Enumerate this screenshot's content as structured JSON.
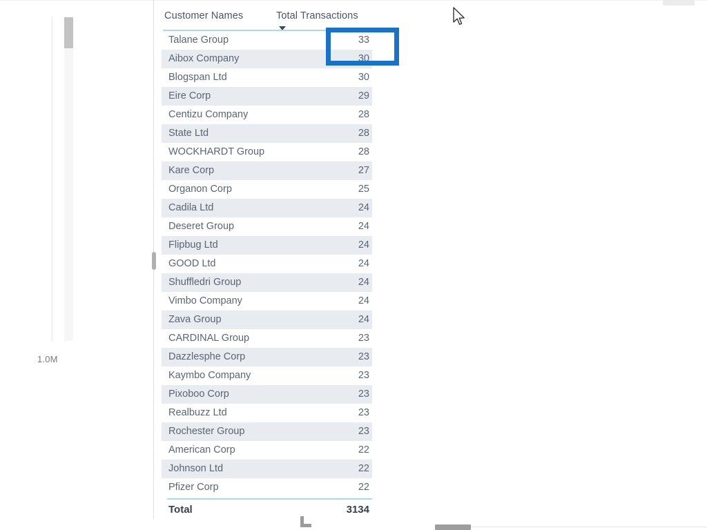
{
  "app": {
    "type": "power-bi-table-visual"
  },
  "left_chart": {
    "axis_tick_label": "1.0M"
  },
  "table": {
    "columns": [
      "Customer Names",
      "Total Transactions"
    ],
    "sort": {
      "column": "Total Transactions",
      "direction": "descending",
      "glyph": "sort-descending-icon"
    },
    "rows": [
      {
        "name": "Talane Group",
        "value": "33"
      },
      {
        "name": "Aibox Company",
        "value": "30"
      },
      {
        "name": "Blogspan Ltd",
        "value": "30"
      },
      {
        "name": "Eire Corp",
        "value": "29"
      },
      {
        "name": "Centizu Company",
        "value": "28"
      },
      {
        "name": "State Ltd",
        "value": "28"
      },
      {
        "name": "WOCKHARDT Group",
        "value": "28"
      },
      {
        "name": "Kare Corp",
        "value": "27"
      },
      {
        "name": "Organon Corp",
        "value": "25"
      },
      {
        "name": "Cadila Ltd",
        "value": "24"
      },
      {
        "name": "Deseret Group",
        "value": "24"
      },
      {
        "name": "Flipbug Ltd",
        "value": "24"
      },
      {
        "name": "GOOD Ltd",
        "value": "24"
      },
      {
        "name": "Shuffledri Group",
        "value": "24"
      },
      {
        "name": "Vimbo Company",
        "value": "24"
      },
      {
        "name": "Zava Group",
        "value": "24"
      },
      {
        "name": "CARDINAL Group",
        "value": "23"
      },
      {
        "name": "Dazzlesphe Corp",
        "value": "23"
      },
      {
        "name": "Kaymbo Company",
        "value": "23"
      },
      {
        "name": "Pixoboo Corp",
        "value": "23"
      },
      {
        "name": "Realbuzz Ltd",
        "value": "23"
      },
      {
        "name": "Rochester Group",
        "value": "23"
      },
      {
        "name": "American Corp",
        "value": "22"
      },
      {
        "name": "Johnson Ltd",
        "value": "22"
      },
      {
        "name": "Pfizer Corp",
        "value": "22"
      }
    ],
    "total_row": {
      "name": "Total",
      "value": "3134"
    }
  },
  "annotation": {
    "kind": "highlight-rectangle",
    "color": "#1b72c4",
    "targets_cell_value": "33"
  },
  "chart_data": {
    "type": "table",
    "title": "",
    "columns": [
      "Customer Names",
      "Total Transactions"
    ],
    "categories": [
      "Talane Group",
      "Aibox Company",
      "Blogspan Ltd",
      "Eire Corp",
      "Centizu Company",
      "State Ltd",
      "WOCKHARDT Group",
      "Kare Corp",
      "Organon Corp",
      "Cadila Ltd",
      "Deseret Group",
      "Flipbug Ltd",
      "GOOD Ltd",
      "Shuffledri Group",
      "Vimbo Company",
      "Zava Group",
      "CARDINAL Group",
      "Dazzlesphe Corp",
      "Kaymbo Company",
      "Pixoboo Corp",
      "Realbuzz Ltd",
      "Rochester Group",
      "American Corp",
      "Johnson Ltd",
      "Pfizer Corp"
    ],
    "values": [
      33,
      30,
      30,
      29,
      28,
      28,
      28,
      27,
      25,
      24,
      24,
      24,
      24,
      24,
      24,
      24,
      23,
      23,
      23,
      23,
      23,
      23,
      22,
      22,
      22
    ],
    "total": 3134,
    "sorted_by": "Total Transactions",
    "sort_order": "descending",
    "xlabel": "Customer Names",
    "ylabel": "Total Transactions"
  }
}
